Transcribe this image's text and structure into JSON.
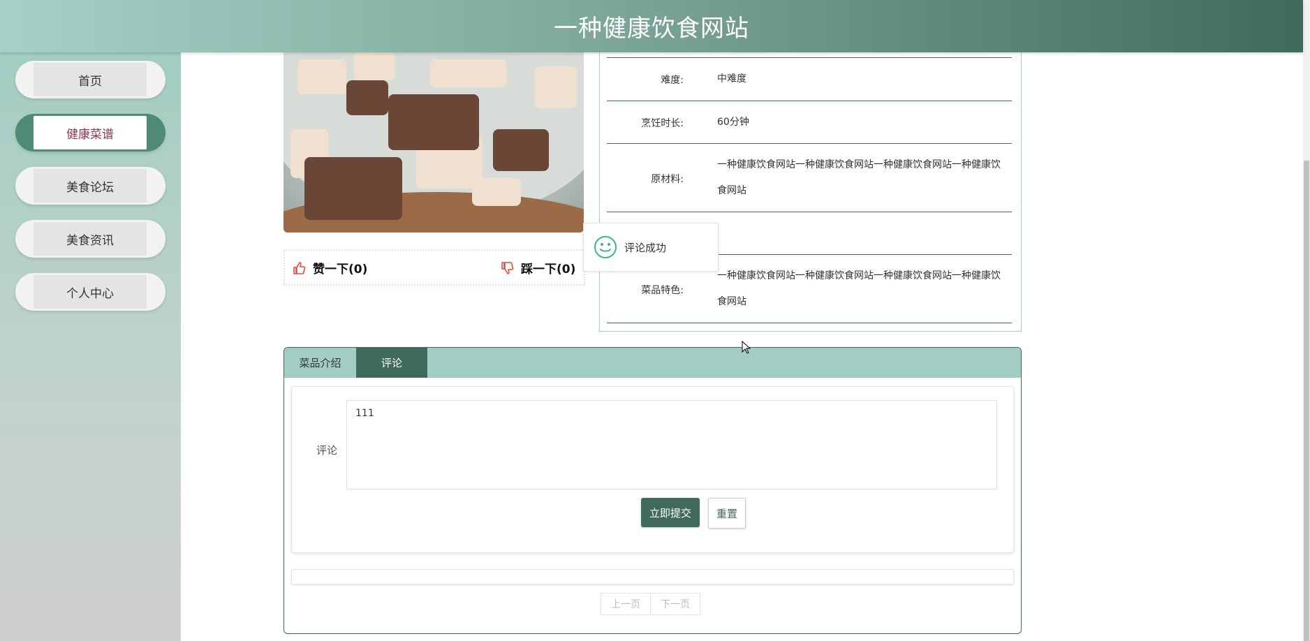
{
  "header": {
    "title": "一种健康饮食网站",
    "accent_color": "#3f6a5c"
  },
  "sidebar": {
    "items": [
      {
        "label": "首页",
        "active": false
      },
      {
        "label": "健康菜谱",
        "active": true
      },
      {
        "label": "美食论坛",
        "active": false
      },
      {
        "label": "美食资讯",
        "active": false
      },
      {
        "label": "个人中心",
        "active": false
      }
    ]
  },
  "votes": {
    "like_label": "赞一下(0)",
    "dislike_label": "踩一下(0)"
  },
  "toast": {
    "message": "评论成功",
    "icon": "smiley-icon"
  },
  "details": {
    "rows": [
      {
        "label": "难度:",
        "value": "中难度"
      },
      {
        "label": "烹饪时长:",
        "value": "60分钟"
      },
      {
        "label": "原材料:",
        "value": "一种健康饮食网站一种健康饮食网站一种健康饮食网站一种健康饮食网站"
      },
      {
        "label": "",
        "value": ""
      },
      {
        "label": "菜品特色:",
        "value": "一种健康饮食网站一种健康饮食网站一种健康饮食网站一种健康饮食网站"
      }
    ]
  },
  "tabs": {
    "items": [
      {
        "label": "菜品介绍",
        "active": false
      },
      {
        "label": "评论",
        "active": true
      }
    ]
  },
  "comment_form": {
    "label": "评论",
    "value": "111",
    "submit_label": "立即提交",
    "reset_label": "重置"
  },
  "pager": {
    "prev_label": "上一页",
    "next_label": "下一页"
  }
}
